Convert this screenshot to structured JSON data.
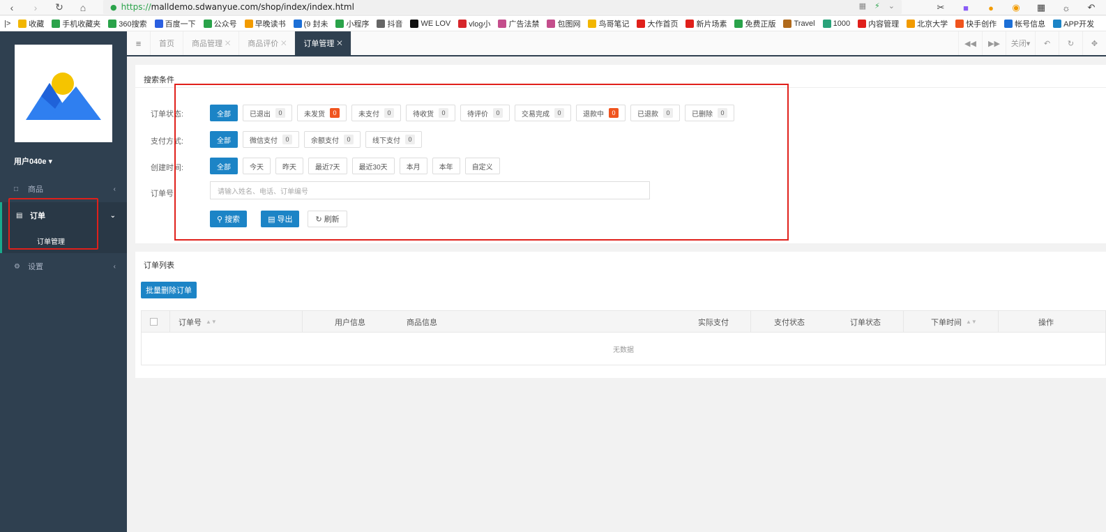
{
  "browser": {
    "url_scheme": "https://",
    "url_rest": "malldemo.sdwanyue.com/shop/index/index.html",
    "bookmarks": [
      {
        "label": "收藏",
        "color": "#f2b600"
      },
      {
        "label": "手机收藏夹",
        "color": "#2aa34a"
      },
      {
        "label": "360搜索",
        "color": "#2aa34a"
      },
      {
        "label": "百度一下",
        "color": "#2b5fe0"
      },
      {
        "label": "公众号",
        "color": "#2aa34a"
      },
      {
        "label": "早晚读书",
        "color": "#f29b00"
      },
      {
        "label": "(9 封未",
        "color": "#1c6fd6"
      },
      {
        "label": "小程序",
        "color": "#2aa34a"
      },
      {
        "label": "抖音",
        "color": "#666666"
      },
      {
        "label": "WE LOV",
        "color": "#111111"
      },
      {
        "label": "vlog小",
        "color": "#d6262b"
      },
      {
        "label": "广告法禁",
        "color": "#c44e8c"
      },
      {
        "label": "包图网",
        "color": "#c44e8c"
      },
      {
        "label": "鸟哥笔记",
        "color": "#f2b600"
      },
      {
        "label": "大作首页",
        "color": "#e0201b"
      },
      {
        "label": "新片场素",
        "color": "#e0201b"
      },
      {
        "label": "免费正版",
        "color": "#2aa34a"
      },
      {
        "label": "Travel",
        "color": "#b06a1c"
      },
      {
        "label": "1000",
        "color": "#2aa37a"
      },
      {
        "label": "内容管理",
        "color": "#e0201b"
      },
      {
        "label": "北京大学",
        "color": "#f29b00"
      },
      {
        "label": "快手创作",
        "color": "#f0541e"
      },
      {
        "label": "帐号信息",
        "color": "#1c6fd6"
      },
      {
        "label": "APP开发",
        "color": "#1c84c6"
      }
    ]
  },
  "sidebar": {
    "user": "用户040e ▾",
    "menu": [
      {
        "label": "商品",
        "icon": "monitor-icon"
      },
      {
        "label": "订单",
        "icon": "document-icon"
      },
      {
        "label": "设置",
        "icon": "gear-icon"
      }
    ],
    "submenu": "订单管理"
  },
  "tabs": [
    {
      "label": "首页"
    },
    {
      "label": "商品管理"
    },
    {
      "label": "商品评价"
    },
    {
      "label": "订单管理"
    }
  ],
  "tab_right": {
    "close": "关闭▾"
  },
  "search": {
    "title": "搜索条件",
    "status_label": "订单状态:",
    "status": [
      {
        "label": "全部",
        "count": ""
      },
      {
        "label": "已退出",
        "count": "0"
      },
      {
        "label": "未发货",
        "count": "0"
      },
      {
        "label": "未支付",
        "count": "0"
      },
      {
        "label": "待收货",
        "count": "0"
      },
      {
        "label": "待评价",
        "count": "0"
      },
      {
        "label": "交易完成",
        "count": "0"
      },
      {
        "label": "退款中",
        "count": "0"
      },
      {
        "label": "已退款",
        "count": "0"
      },
      {
        "label": "已删除",
        "count": "0"
      }
    ],
    "pay_label": "支付方式:",
    "pay": [
      {
        "label": "全部",
        "count": ""
      },
      {
        "label": "微信支付",
        "count": "0"
      },
      {
        "label": "余额支付",
        "count": "0"
      },
      {
        "label": "线下支付",
        "count": "0"
      }
    ],
    "time_label": "创建时间:",
    "time": [
      "全部",
      "今天",
      "昨天",
      "最近7天",
      "最近30天",
      "本月",
      "本年",
      "自定义"
    ],
    "order_label": "订单号:",
    "order_placeholder": "请输入姓名、电话、订单编号",
    "btn_search": "搜索",
    "btn_export": "导出",
    "btn_refresh": "刷新"
  },
  "list": {
    "title": "订单列表",
    "batch_delete": "批量删除订单",
    "columns": [
      "订单号",
      "用户信息",
      "商品信息",
      "实际支付",
      "支付状态",
      "订单状态",
      "下单时间",
      "操作"
    ],
    "empty": "无数据"
  }
}
